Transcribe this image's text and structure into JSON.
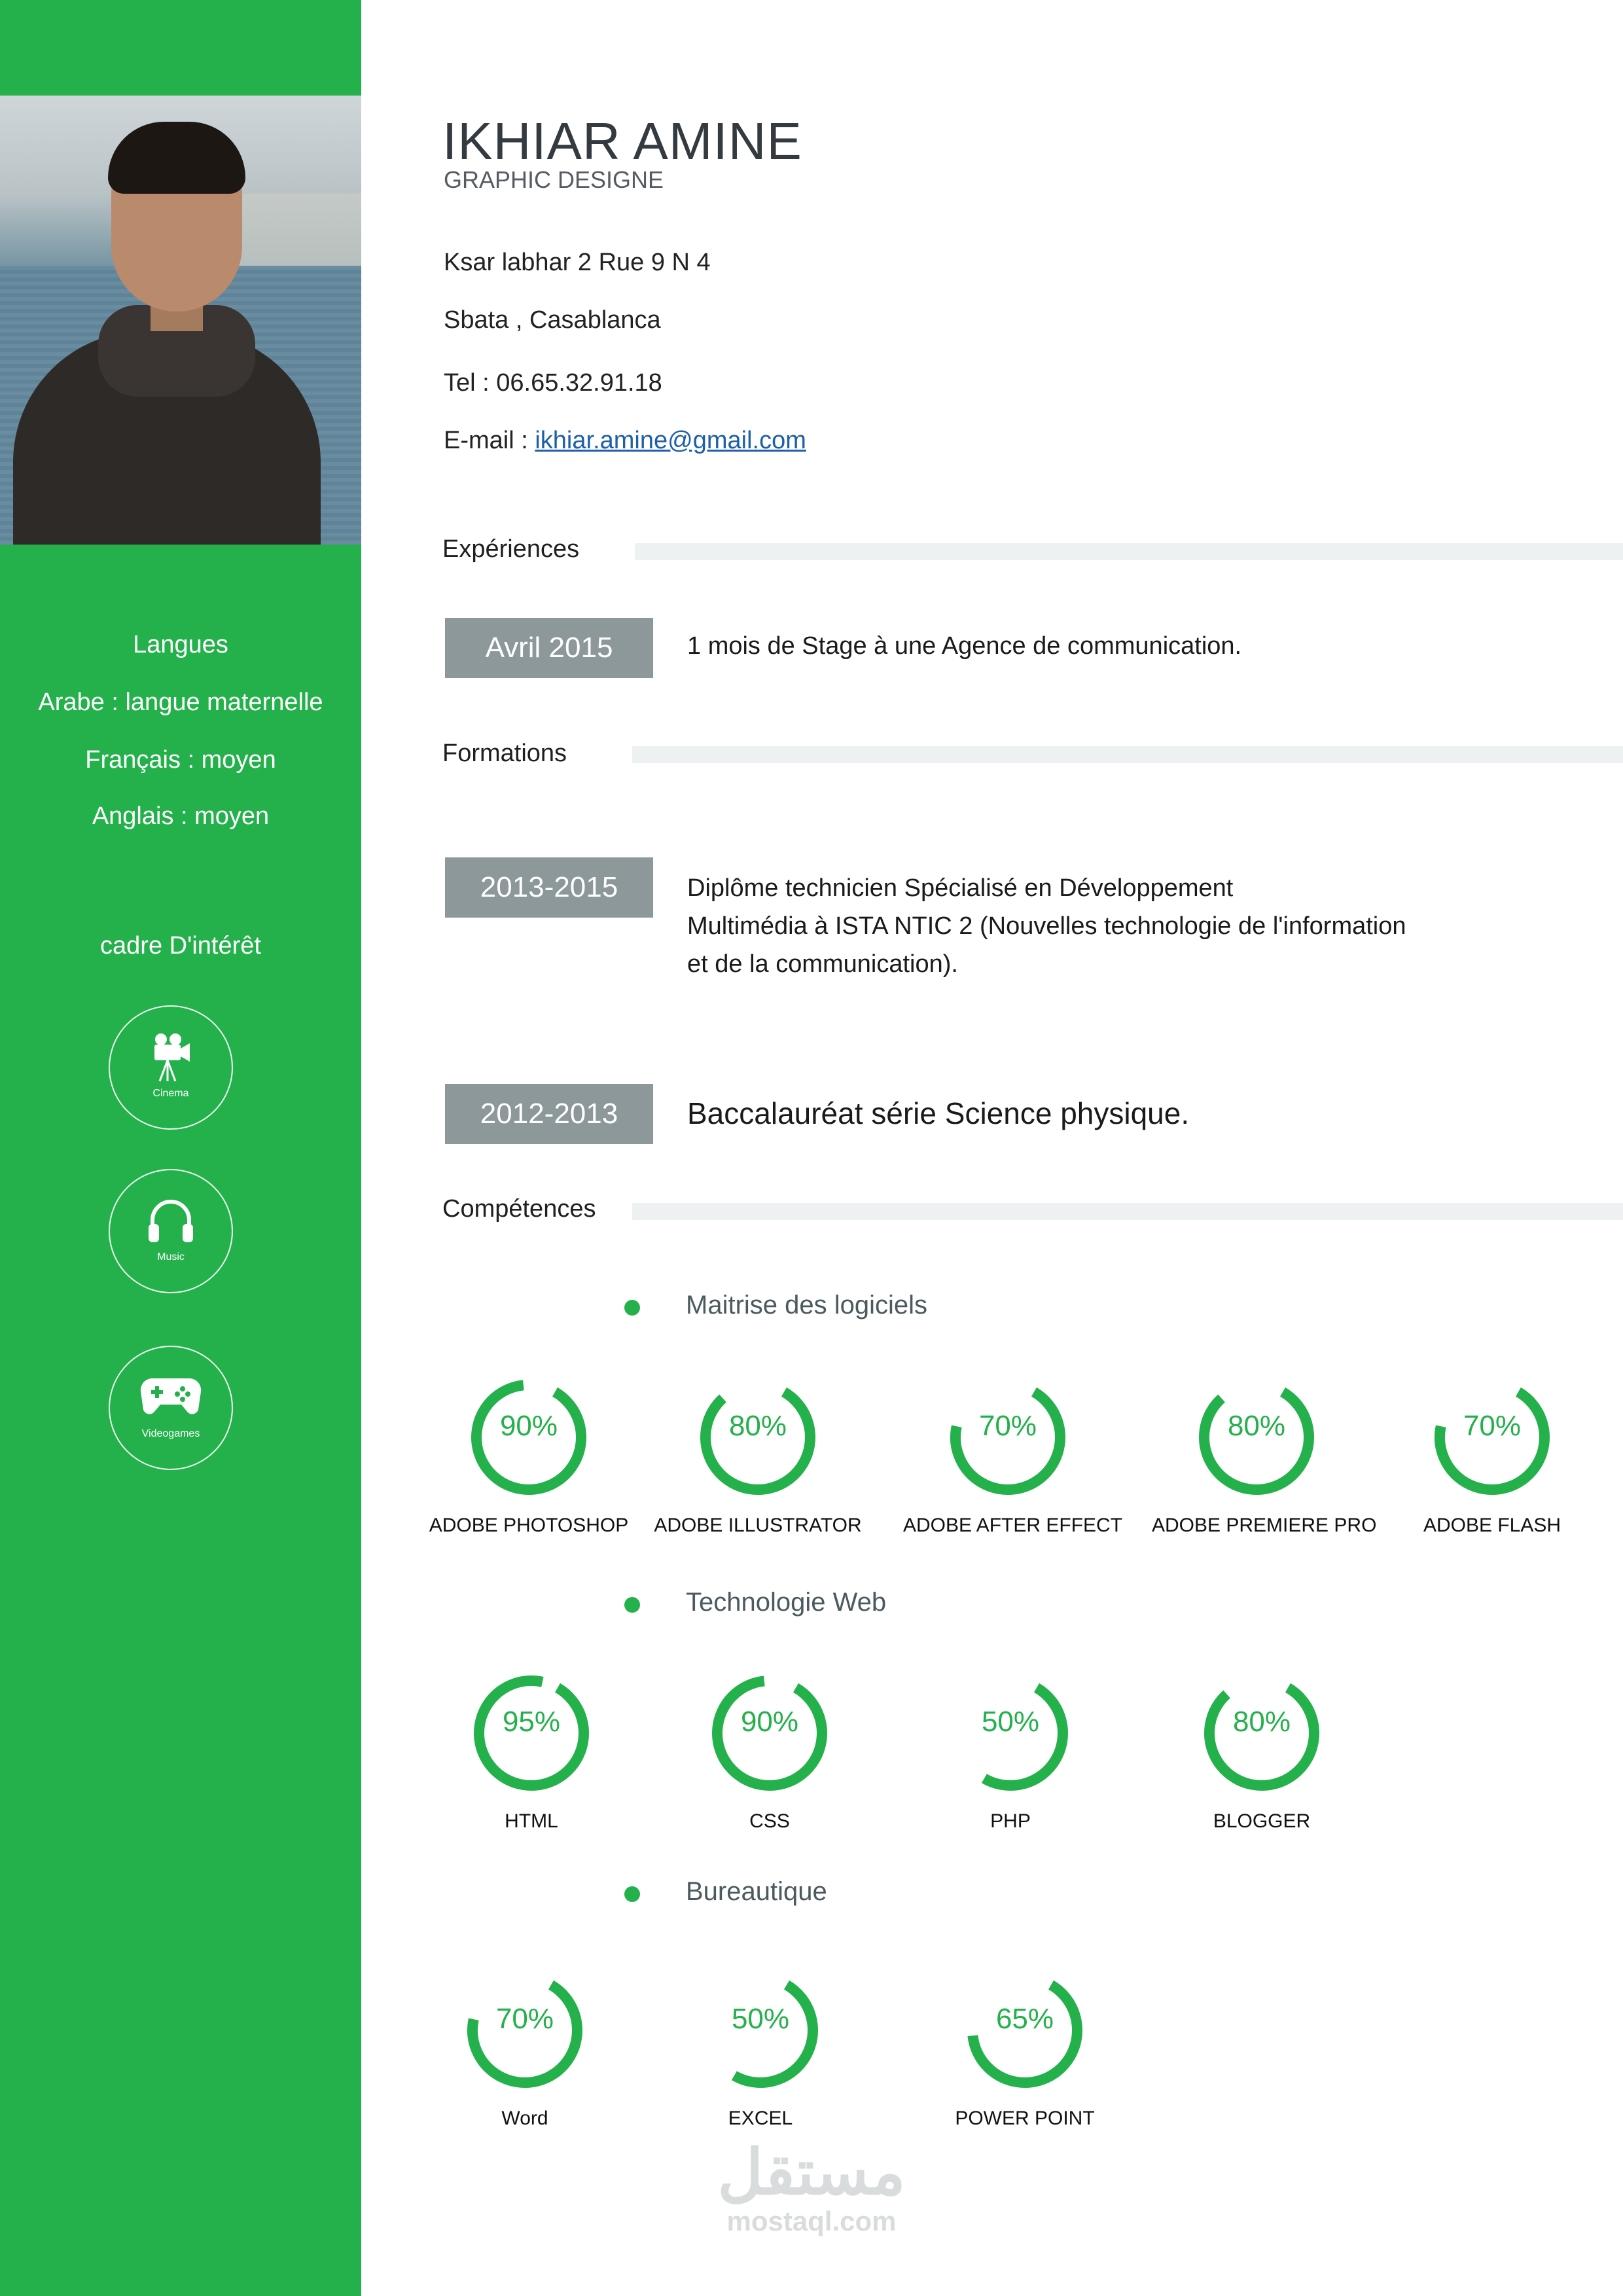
{
  "profile": {
    "name": "IKHIAR AMINE",
    "title": "GRAPHIC DESIGNE",
    "address1": "Ksar labhar 2 Rue 9 N 4",
    "address2": "Sbata , Casablanca",
    "tel": "Tel : 06.65.32.91.18",
    "email_prefix": "E-mail : ",
    "email": "ikhiar.amine@gmail.com"
  },
  "sidebar": {
    "languages_title": "Langues",
    "languages": [
      "Arabe : langue maternelle",
      "Français : moyen",
      "Anglais : moyen"
    ],
    "interests_title": "cadre D'intérêt",
    "interests": [
      {
        "label": "Cinema",
        "icon": "movie-camera-icon"
      },
      {
        "label": "Music",
        "icon": "headphones-icon"
      },
      {
        "label": "Videogames",
        "icon": "gamepad-icon"
      }
    ]
  },
  "sections": {
    "experiences": "Expériences",
    "formations": "Formations",
    "competences": "Compétences"
  },
  "experiences": [
    {
      "date": "Avril 2015",
      "text": "1 mois de Stage à une Agence de communication."
    }
  ],
  "formations": [
    {
      "date": "2013-2015",
      "lines": [
        "Diplôme technicien Spécialisé en Développement",
        "Multimédia à ISTA NTIC 2 (Nouvelles technologie de l'information",
        "et de la communication)."
      ]
    },
    {
      "date": "2012-2013",
      "lines": [
        "Baccalauréat série Science physique."
      ]
    }
  ],
  "skills": [
    {
      "category": "Maitrise des logiciels",
      "items": [
        {
          "name": "ADOBE PHOTOSHOP",
          "value": 90,
          "label": "90%"
        },
        {
          "name": "ADOBE ILLUSTRATOR",
          "value": 80,
          "label": "80%"
        },
        {
          "name": "ADOBE AFTER EFFECT",
          "value": 70,
          "label": "70%"
        },
        {
          "name": "ADOBE PREMIERE PRO",
          "value": 80,
          "label": "80%"
        },
        {
          "name": "ADOBE FLASH",
          "value": 70,
          "label": "70%"
        }
      ]
    },
    {
      "category": "Technologie Web",
      "items": [
        {
          "name": "HTML",
          "value": 95,
          "label": "95%"
        },
        {
          "name": "CSS",
          "value": 90,
          "label": "90%"
        },
        {
          "name": "PHP",
          "value": 50,
          "label": "50%"
        },
        {
          "name": "BLOGGER",
          "value": 80,
          "label": "80%"
        }
      ]
    },
    {
      "category": "Bureautique",
      "items": [
        {
          "name": "Word",
          "value": 70,
          "label": "70%"
        },
        {
          "name": "EXCEL",
          "value": 50,
          "label": "50%"
        },
        {
          "name": "POWER POINT",
          "value": 65,
          "label": "65%"
        }
      ]
    }
  ],
  "watermark": {
    "arabic": "مستقل",
    "latin": "mostaql.com"
  },
  "colors": {
    "accent": "#24b14b",
    "date_box": "#8c9899",
    "bar": "#eef1f1"
  }
}
